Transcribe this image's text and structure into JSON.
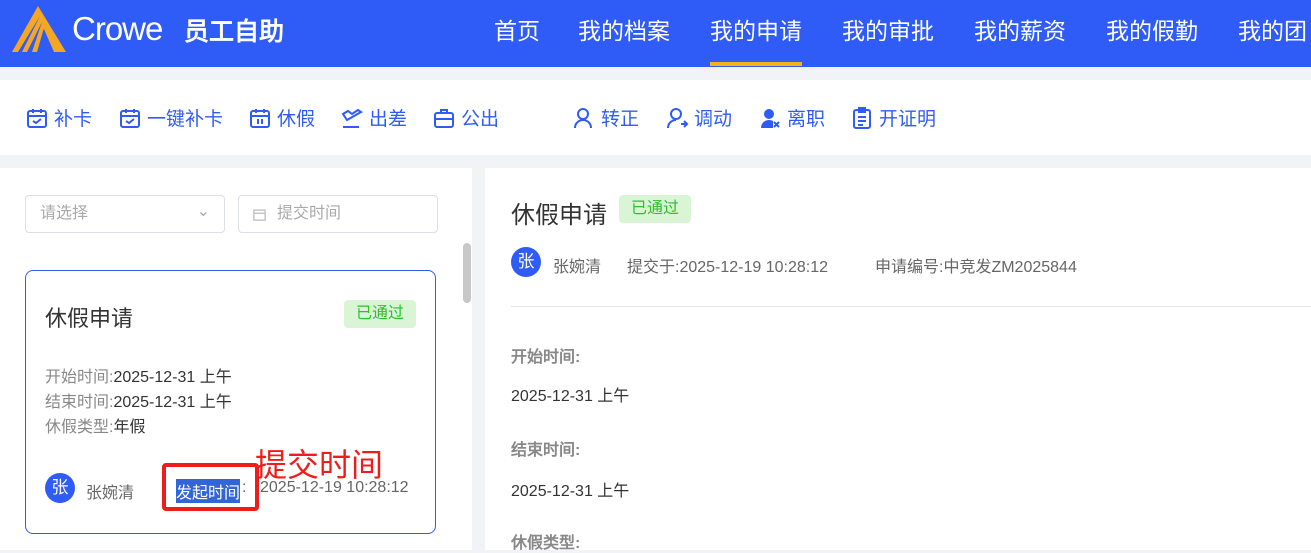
{
  "header": {
    "brand": "Crowe",
    "app_name": "员工自助",
    "nav": [
      "首页",
      "我的档案",
      "我的申请",
      "我的审批",
      "我的薪资",
      "我的假勤",
      "我的团"
    ],
    "active": "我的申请"
  },
  "toolbar": [
    "补卡",
    "一键补卡",
    "休假",
    "出差",
    "公出",
    "转正",
    "调动",
    "离职",
    "开证明"
  ],
  "filters": {
    "select_placeholder": "请选择",
    "date_placeholder": "提交时间"
  },
  "card": {
    "title": "休假申请",
    "status": "已通过",
    "fields": [
      {
        "label": "开始时间:",
        "value": "2025-12-31 上午"
      },
      {
        "label": "结束时间:",
        "value": "2025-12-31 上午"
      },
      {
        "label": "休假类型:",
        "value": "年假"
      }
    ],
    "avatar": "张",
    "applicant": "张婉清",
    "time_label": "发起时间",
    "time_sep": ":",
    "time_value": "2025-12-19 10:28:12"
  },
  "annotation": {
    "text": "提交时间"
  },
  "detail": {
    "title": "休假申请",
    "status": "已通过",
    "avatar": "张",
    "applicant": "张婉清",
    "submitted": "提交于:2025-12-19 10:28:12",
    "number": "申请编号:中竞发ZM2025844",
    "fields": [
      {
        "label": "开始时间:",
        "value": "2025-12-31 上午"
      },
      {
        "label": "结束时间:",
        "value": "2025-12-31 上午"
      },
      {
        "label": "休假类型:"
      }
    ]
  }
}
